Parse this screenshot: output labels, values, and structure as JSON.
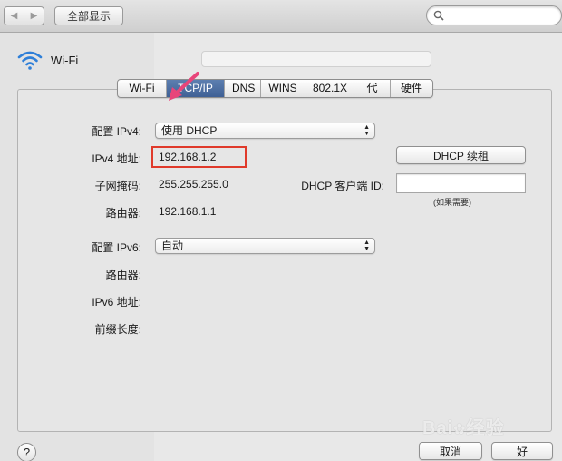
{
  "toolbar": {
    "back": "◀",
    "forward": "▶",
    "show_all": "全部显示",
    "search_value": ""
  },
  "sidebar": {
    "selected_service": "Wi-Fi"
  },
  "tabs": [
    "Wi-Fi",
    "TCP/IP",
    "DNS",
    "WINS",
    "802.1X",
    "代理",
    "硬件"
  ],
  "active_tab": "TCP/IP",
  "ipv4": {
    "configure_label": "配置 IPv4:",
    "configure_value": "使用 DHCP",
    "address_label": "IPv4 地址:",
    "address_value": "192.168.1.2",
    "subnet_label": "子网掩码:",
    "subnet_value": "255.255.255.0",
    "router_label": "路由器:",
    "router_value": "192.168.1.1",
    "renew_button": "DHCP 续租",
    "client_id_label": "DHCP 客户端 ID:",
    "client_id_value": "",
    "client_id_hint": "(如果需要)"
  },
  "ipv6": {
    "configure_label": "配置 IPv6:",
    "configure_value": "自动",
    "router_label": "路由器:",
    "address_label": "IPv6 地址:",
    "prefix_label": "前缀长度:"
  },
  "footer": {
    "help": "?",
    "cancel": "取消",
    "ok": "好"
  },
  "watermark": "Baidu 经验",
  "colors": {
    "highlight_border": "#e03a2b",
    "arrow": "#e8457a",
    "active_tab": "#4a6ba0"
  }
}
